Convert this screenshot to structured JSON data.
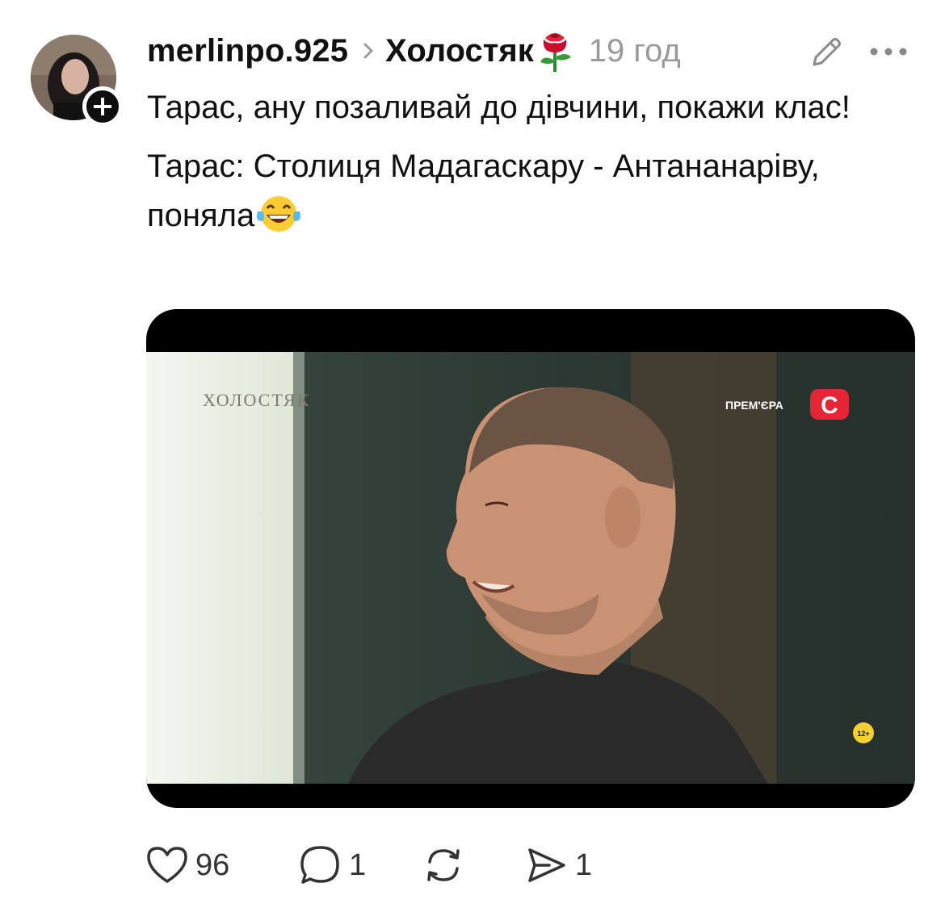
{
  "post": {
    "author": "merlinpo.925",
    "community": "Холостяк",
    "community_emoji": "rose-icon",
    "time": "19 год",
    "text_line1": "Тарас, ану позаливай до дівчини, покажи клас!",
    "text_line2": "Тарас: Столиця Мадагаскару - Антананаріву, поняла",
    "text_emoji": "laughing-tears-emoji"
  },
  "media": {
    "watermark": "ХОЛОСТЯК",
    "premiere_label": "ПРЕМ'ЄРА",
    "channel_logo": "С",
    "age_rating": "12+"
  },
  "actions": {
    "likes": "96",
    "comments": "1",
    "reposts": "",
    "shares": "1"
  },
  "colors": {
    "text": "#111111",
    "muted": "#9a9a9a",
    "channel_red": "#e52535"
  }
}
